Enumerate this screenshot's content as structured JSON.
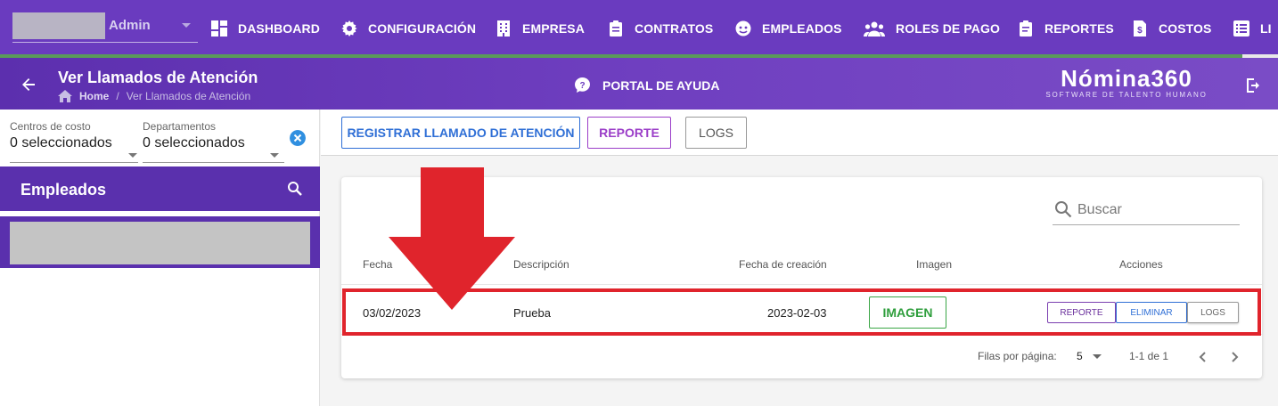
{
  "user": {
    "name": "Admin"
  },
  "nav": {
    "items": [
      {
        "label": "DASHBOARD",
        "icon": "dashboard-icon"
      },
      {
        "label": "CONFIGURACIÓN",
        "icon": "gear-icon"
      },
      {
        "label": "EMPRESA",
        "icon": "building-icon"
      },
      {
        "label": "CONTRATOS",
        "icon": "clipboard-icon"
      },
      {
        "label": "EMPLEADOS",
        "icon": "face-icon"
      },
      {
        "label": "ROLES DE PAGO",
        "icon": "group-icon"
      },
      {
        "label": "REPORTES",
        "icon": "clipboard-list-icon"
      },
      {
        "label": "COSTOS",
        "icon": "dollar-file-icon"
      },
      {
        "label": "LI",
        "icon": "list-icon"
      }
    ]
  },
  "subheader": {
    "title": "Ver Llamados de Atención",
    "breadcrumb_home": "Home",
    "breadcrumb_sep": "/",
    "breadcrumb_current": "Ver Llamados de Atención",
    "help_label": "PORTAL DE AYUDA",
    "brand_name": "Nómina360",
    "brand_tagline": "SOFTWARE DE TALENTO HUMANO"
  },
  "filters": {
    "cost_center_label": "Centros de costo",
    "cost_center_value": "0 seleccionados",
    "department_label": "Departamentos",
    "department_value": "0 seleccionados"
  },
  "employees": {
    "title": "Empleados"
  },
  "toolbar": {
    "register_label": "REGISTRAR LLAMADO DE ATENCIÓN",
    "report_label": "REPORTE",
    "logs_label": "LOGS"
  },
  "table": {
    "search_placeholder": "Buscar",
    "columns": [
      "Fecha",
      "Descripción",
      "Fecha de creación",
      "Imagen",
      "Acciones"
    ],
    "rows": [
      {
        "fecha": "03/02/2023",
        "descripcion": "Prueba",
        "fecha_creacion": "2023-02-03",
        "imagen_label": "IMAGEN",
        "actions": [
          "REPORTE",
          "ELIMINAR",
          "LOGS"
        ]
      }
    ],
    "rows_per_page_label": "Filas por página:",
    "rows_per_page_value": "5",
    "range_label": "1-1 de 1"
  },
  "colors": {
    "brand_purple": "#6a3bbf",
    "header_purple": "#5a30ad",
    "primary_blue": "#2f6fd6",
    "report_purple": "#9b3ec8",
    "image_green": "#2e9e3c",
    "annotation_red": "#e0242c"
  }
}
